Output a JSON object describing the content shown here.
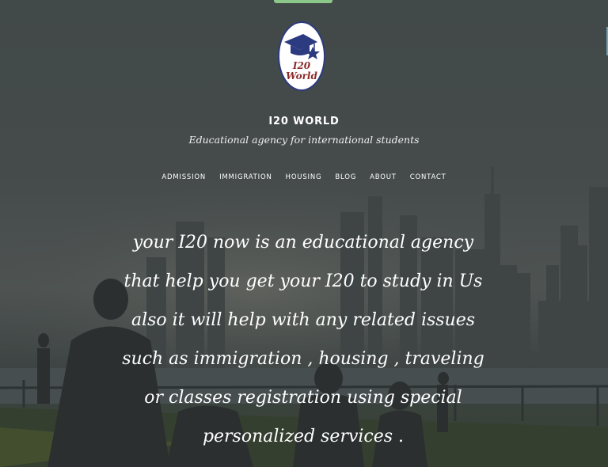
{
  "brand": {
    "logo_text": "I20 World",
    "name": "I20 WORLD",
    "tagline": "Educational agency for international students"
  },
  "nav": {
    "items": [
      {
        "label": "ADMISSION"
      },
      {
        "label": "IMMIGRATION"
      },
      {
        "label": "HOUSING"
      },
      {
        "label": "BLOG"
      },
      {
        "label": "ABOUT"
      },
      {
        "label": "CONTACT"
      }
    ]
  },
  "hero": {
    "lines": [
      "your I20 now is an educational agency",
      "that help you get your I20 to study in Us",
      "also it will help with any related issues",
      "such as immigration , housing , traveling",
      "or classes registration using special",
      "personalized services ."
    ]
  },
  "colors": {
    "accent": "#8cc78a",
    "logo_border": "#2c3a80",
    "logo_text": "#8b2b2b"
  },
  "icons": {
    "logo_mark": "graduation-cap-icon",
    "logo_star": "star-icon"
  }
}
